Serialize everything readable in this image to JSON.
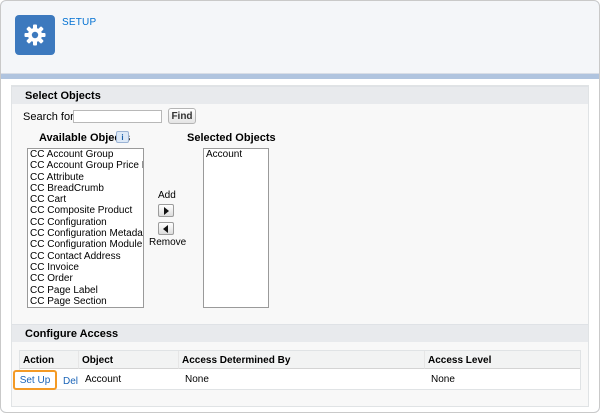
{
  "header": {
    "title": "SETUP",
    "icon": "gear-icon"
  },
  "select_objects": {
    "section_title": "Select Objects",
    "search_label": "Search  for:",
    "search_value": "",
    "find_button": "Find",
    "available_label": "Available Objects",
    "info_glyph": "i",
    "selected_label": "Selected Objects",
    "available_items": [
      "CC Account Group",
      "CC Account Group Price List",
      "CC Attribute",
      "CC BreadCrumb",
      "CC Cart",
      "CC Composite Product",
      "CC Configuration",
      "CC Configuration Metadata",
      "CC Configuration Module",
      "CC Contact Address",
      "CC Invoice",
      "CC Order",
      "CC Page Label",
      "CC Page Section"
    ],
    "selected_items": [
      "Account"
    ],
    "add_label": "Add",
    "remove_label": "Remove"
  },
  "configure_access": {
    "section_title": "Configure Access",
    "columns": [
      "Action",
      "Object",
      "Access Determined By",
      "Access Level"
    ],
    "row": {
      "setup_link": "Set Up",
      "del_link": "Del",
      "object": "Account",
      "determined_by": "None",
      "access_level": "None"
    }
  },
  "colors": {
    "brand_icon_bg": "#3c79be",
    "link": "#0070d2",
    "highlight": "#f49a25",
    "frame_band": "#b0c4df"
  }
}
